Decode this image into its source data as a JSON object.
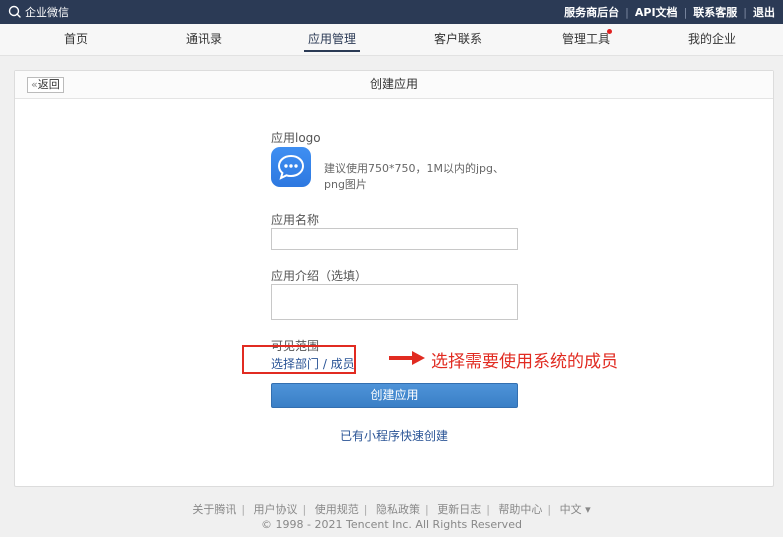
{
  "topbar": {
    "logo_text": "企业微信",
    "links": [
      "服务商后台",
      "API文档",
      "联系客服",
      "退出"
    ]
  },
  "nav": {
    "items": [
      "首页",
      "通讯录",
      "应用管理",
      "客户联系",
      "管理工具",
      "我的企业"
    ],
    "active": "应用管理"
  },
  "page": {
    "back_label": "返回",
    "back_chevron": "«",
    "title": "创建应用",
    "logo_label": "应用logo",
    "logo_hint": "建议使用750*750，1M以内的jpg、png图片",
    "name_label": "应用名称",
    "name_value": "",
    "intro_label": "应用介绍（选填）",
    "intro_value": "",
    "scope_label": "可见范围",
    "scope_link": "选择部门 / 成员",
    "create_button": "创建应用",
    "miniprogram_link": "已有小程序快速创建"
  },
  "annotation": {
    "text": "选择需要使用系统的成员",
    "color": "#e12b21"
  },
  "footer": {
    "links": [
      "关于腾讯",
      "用户协议",
      "使用规范",
      "隐私政策",
      "更新日志",
      "帮助中心",
      "中文"
    ],
    "language_caret": "▾",
    "copyright": "© 1998 - 2021 Tencent Inc. All Rights Reserved"
  },
  "colors": {
    "topbar": "#2b3a55",
    "primary": "#3a7fc6",
    "link": "#2a5496",
    "notification_dot": "#e02020"
  }
}
